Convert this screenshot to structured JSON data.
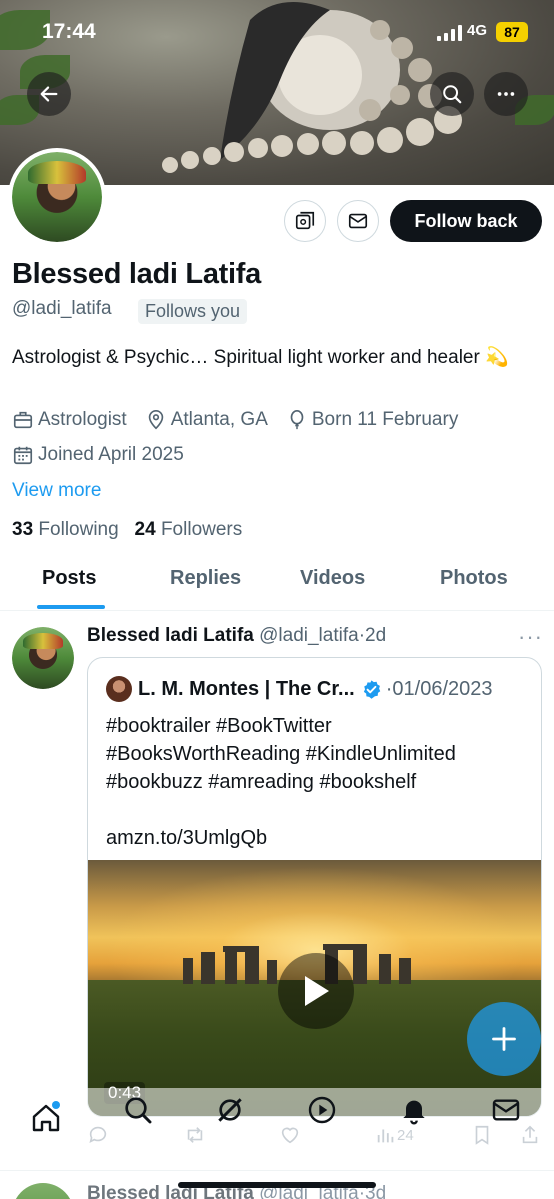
{
  "status_bar": {
    "time": "17:44",
    "network": "4G",
    "battery": "87"
  },
  "profile": {
    "name": "Blessed ladi Latifa",
    "handle": "@ladi_latifa",
    "follows_you": "Follows you",
    "bio": "Astrologist & Psychic… Spiritual light worker and healer 💫",
    "category": "Astrologist",
    "location": "Atlanta, GA",
    "birthday": "Born 11 February",
    "joined": "Joined April 2025",
    "view_more": "View more",
    "following_count": "33",
    "following_label": "Following",
    "followers_count": "24",
    "followers_label": "Followers",
    "follow_back_label": "Follow back"
  },
  "tabs": [
    {
      "label": "Posts"
    },
    {
      "label": "Replies"
    },
    {
      "label": "Videos"
    },
    {
      "label": "Photos"
    }
  ],
  "post": {
    "author": "Blessed ladi Latifa",
    "handle": "@ladi_latifa",
    "sep": "·",
    "time": "2d",
    "more": "···",
    "quote": {
      "author": "L. M. Montes | The Cr...",
      "sep": "·",
      "date": "01/06/2023",
      "text": "#booktrailer #BookTwitter\n#BooksWorthReading #KindleUnlimited\n#bookbuzz #amreading #bookshelf\n\namzn.to/3UmlgQb",
      "video_duration": "0:43"
    },
    "views": "24"
  },
  "next_post": {
    "author": "Blessed ladi Latifa",
    "handle": "@ladi_latifa",
    "sep": "·",
    "time": "3d"
  },
  "colors": {
    "accent": "#1d9bf0",
    "text": "#0f1419",
    "muted": "#536471",
    "follow_bg": "#0f1419",
    "battery": "#f5d000"
  }
}
